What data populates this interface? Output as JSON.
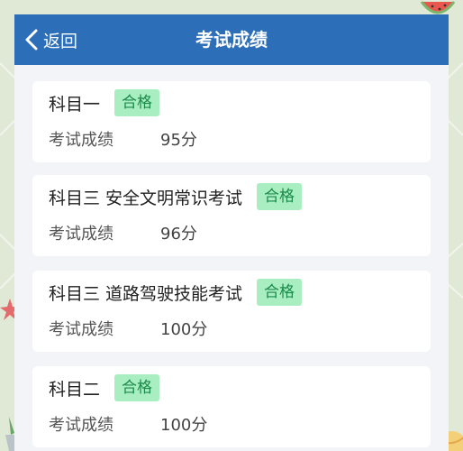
{
  "header": {
    "back_label": "返回",
    "title": "考试成绩"
  },
  "cards": [
    {
      "subject": "科目一",
      "status": "合格",
      "score_label": "考试成绩",
      "score": "95分"
    },
    {
      "subject": "科目三 安全文明常识考试",
      "status": "合格",
      "score_label": "考试成绩",
      "score": "96分"
    },
    {
      "subject": "科目三 道路驾驶技能考试",
      "status": "合格",
      "score_label": "考试成绩",
      "score": "100分"
    },
    {
      "subject": "科目二",
      "status": "合格",
      "score_label": "考试成绩",
      "score": "100分"
    }
  ],
  "colors": {
    "header_bg": "#2c6fb8",
    "badge_bg": "#a9eec0",
    "badge_text": "#1a8a4a",
    "page_bg": "#dfe9d6"
  },
  "decorations": [
    "watermelon-sticker",
    "starfish-sticker",
    "plant-sticker",
    "ball-sticker"
  ]
}
